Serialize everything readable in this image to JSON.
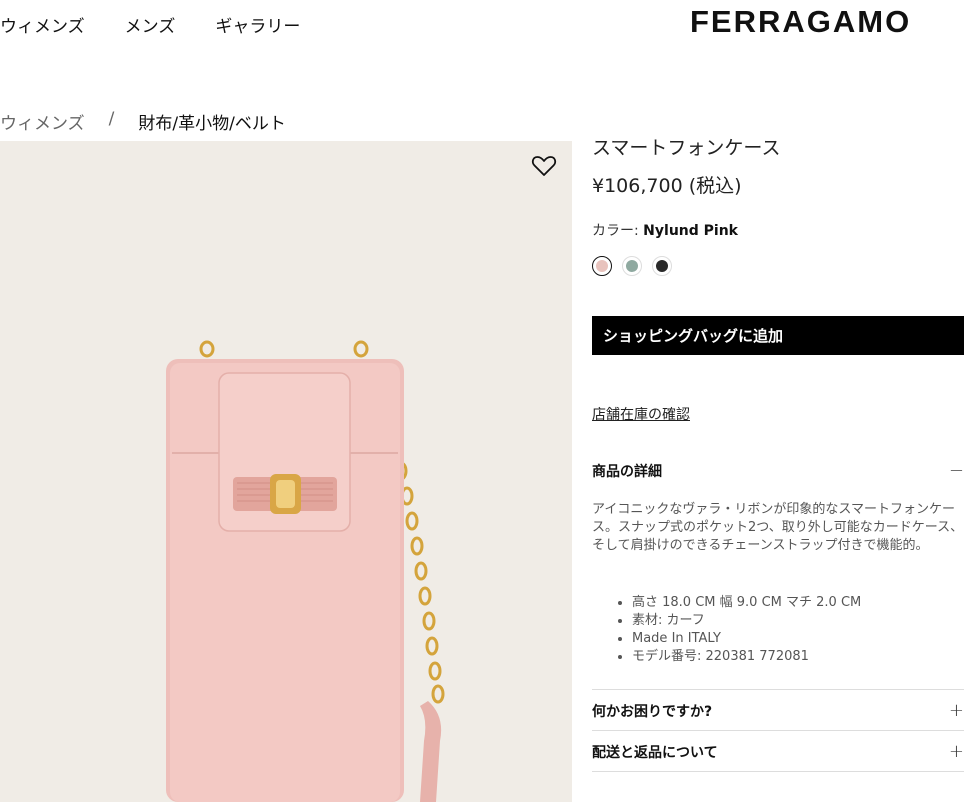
{
  "nav": {
    "items": [
      "ウィメンズ",
      "メンズ",
      "ギャラリー"
    ]
  },
  "brand": {
    "logo": "FERRAGAMO"
  },
  "breadcrumb": {
    "items": [
      "ウィメンズ",
      "/",
      "財布/革小物/ベルト"
    ]
  },
  "product": {
    "title": "スマートフォンケース",
    "price": "¥106,700 (税込)",
    "color_label": "カラー: ",
    "color_value": "Nylund Pink",
    "swatches": [
      {
        "name": "Nylund Pink",
        "color": "#e8c3bd",
        "selected": true
      },
      {
        "name": "Sage",
        "color": "#8fa9a0",
        "selected": false
      },
      {
        "name": "Black",
        "color": "#2a2a2a",
        "selected": false
      }
    ],
    "add_to_bag": "ショッピングバッグに追加",
    "store_stock": "店舗在庫の確認"
  },
  "details": {
    "heading": "商品の詳細",
    "toggle": "−",
    "description": "アイコニックなヴァラ・リボンが印象的なスマートフォンケース。スナップ式のポケット2つ、取り外し可能なカードケース、そして肩掛けのできるチェーンストラップ付きで機能的。",
    "specs": [
      "高さ 18.0 CM  幅 9.0 CM  マチ 2.0 CM",
      "素材: カーフ",
      "Made In ITALY",
      "モデル番号: 220381 772081"
    ]
  },
  "help": {
    "heading": "何かお困りですか?",
    "toggle": "+"
  },
  "shipping": {
    "heading": "配送と返品について",
    "toggle": "+"
  },
  "colors": {
    "accent": "#000000",
    "image_bg": "#f0ece6",
    "product_pink": "#ecc4c0"
  }
}
